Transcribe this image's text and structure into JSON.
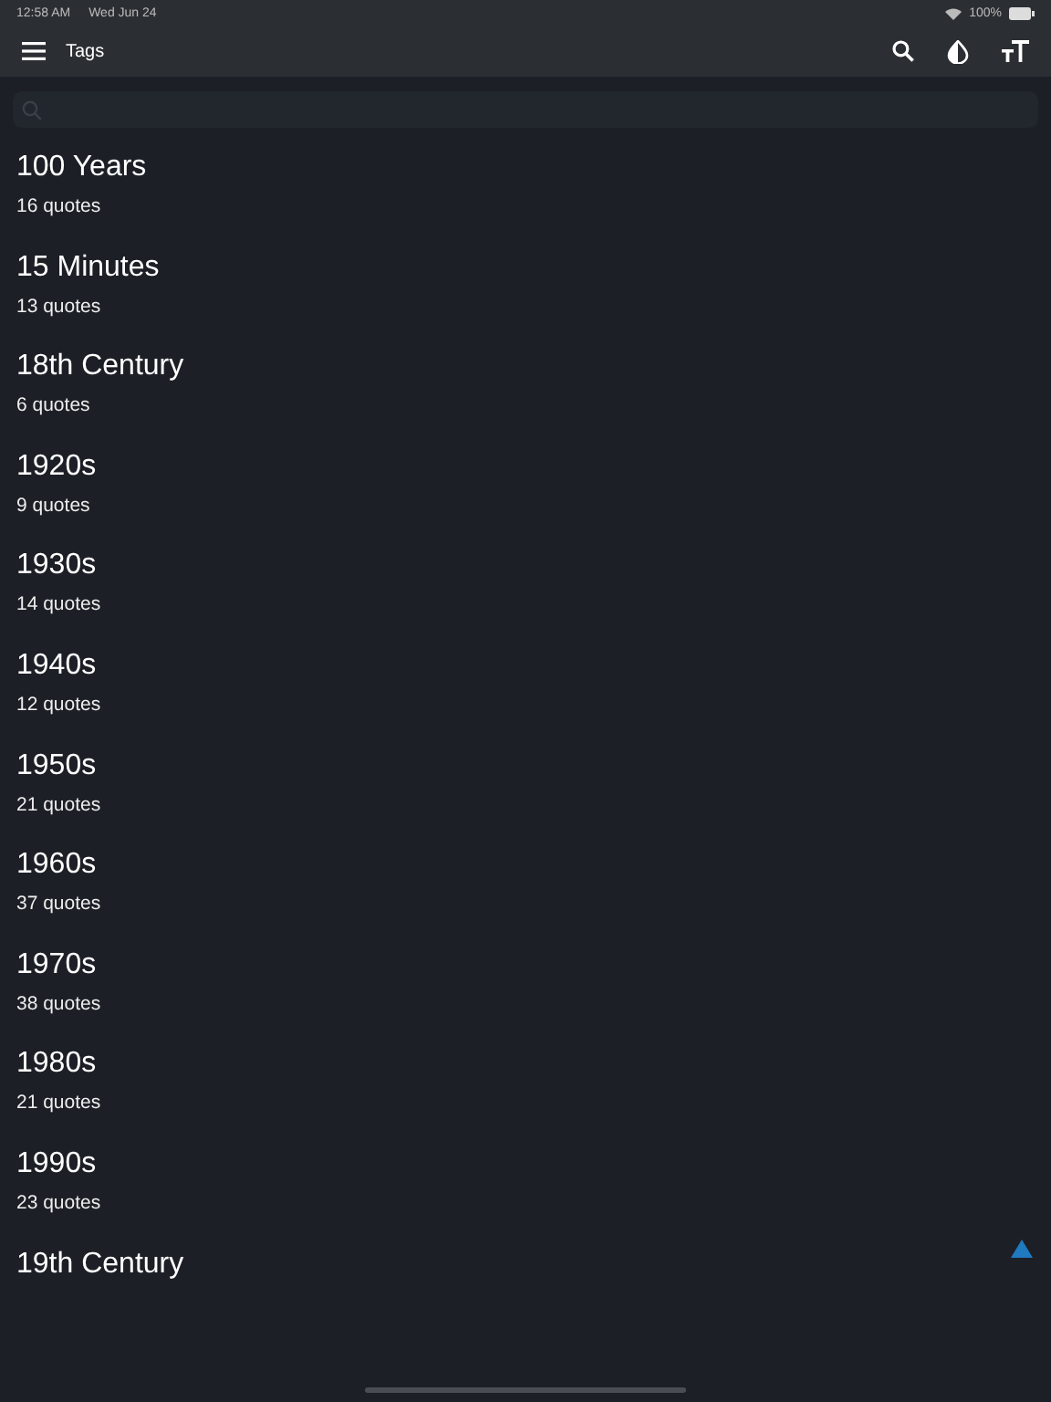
{
  "status_bar": {
    "time": "12:58 AM",
    "date": "Wed Jun 24",
    "battery": "100%"
  },
  "toolbar": {
    "title": "Tags"
  },
  "tags": [
    {
      "name": "100 Years",
      "count": "16 quotes"
    },
    {
      "name": "15 Minutes",
      "count": "13 quotes"
    },
    {
      "name": "18th Century",
      "count": "6 quotes"
    },
    {
      "name": "1920s",
      "count": "9 quotes"
    },
    {
      "name": "1930s",
      "count": "14 quotes"
    },
    {
      "name": "1940s",
      "count": "12 quotes"
    },
    {
      "name": "1950s",
      "count": "21 quotes"
    },
    {
      "name": "1960s",
      "count": "37 quotes"
    },
    {
      "name": "1970s",
      "count": "38 quotes"
    },
    {
      "name": "1980s",
      "count": "21 quotes"
    },
    {
      "name": "1990s",
      "count": "23 quotes"
    },
    {
      "name": "19th Century"
    }
  ]
}
